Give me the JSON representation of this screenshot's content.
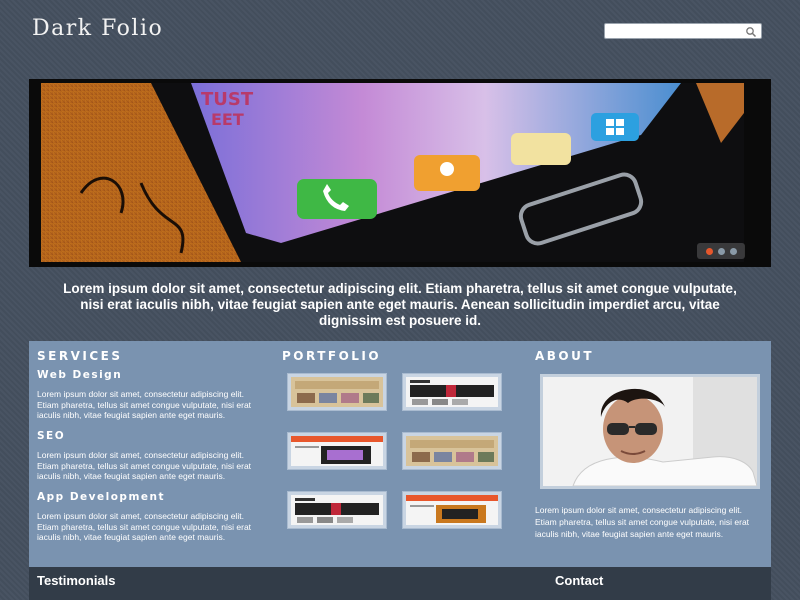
{
  "header": {
    "logo": "Dark Folio",
    "search": {
      "value": "",
      "placeholder": ""
    }
  },
  "slider": {
    "image_alt": "Smartphone screen with app icons",
    "slides_count": 3,
    "active_slide": 1
  },
  "intro": {
    "text": "Lorem ipsum dolor sit amet, consectetur adipiscing elit. Etiam pharetra, tellus sit amet congue vulputate, nisi erat iaculis nibh, vitae feugiat sapien ante eget mauris. Aenean sollicitudin imperdiet arcu, vitae dignissim est posuere id."
  },
  "services": {
    "title": "SERVICES",
    "items": [
      {
        "heading": "Web Design",
        "text": "Lorem ipsum dolor sit amet, consectetur adipiscing elit. Etiam pharetra, tellus sit amet congue vulputate, nisi erat iaculis nibh, vitae feugiat sapien ante eget mauris."
      },
      {
        "heading": "SEO",
        "text": "Lorem ipsum dolor sit amet, consectetur adipiscing elit. Etiam pharetra, tellus sit amet congue vulputate, nisi erat iaculis nibh, vitae feugiat sapien ante eget mauris."
      },
      {
        "heading": "App Development",
        "text": "Lorem ipsum dolor sit amet, consectetur adipiscing elit. Etiam pharetra, tellus sit amet congue vulputate, nisi erat iaculis nibh, vitae feugiat sapien ante eget mauris."
      }
    ]
  },
  "portfolio": {
    "title": "PORTFOLIO",
    "thumbnail_count": 6
  },
  "about": {
    "title": "ABOUT",
    "text": "Lorem ipsum dolor sit amet, consectetur adipiscing elit. Etiam pharetra, tellus sit amet congue vulputate, nisi erat iaculis nibh, vitae feugiat sapien ante eget mauris."
  },
  "footer": {
    "testimonials_title": "Testimonials",
    "contact_title": "Contact"
  },
  "colors": {
    "background": "#45505f",
    "panel": "#7a93b0",
    "footer": "#323c48",
    "accent": "#e6572c"
  }
}
